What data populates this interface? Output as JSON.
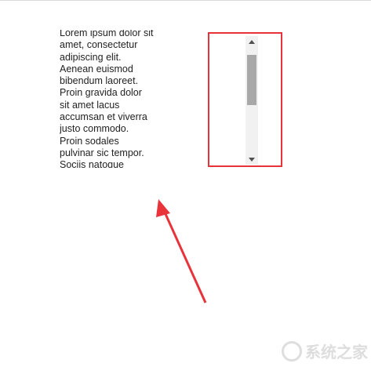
{
  "content": {
    "paragraph": "Lorem ipsum dolor sit\namet, consectetur\nadipiscing elit.\nAenean euismod\nbibendum laoreet.\nProin gravida dolor\nsit amet lacus\naccumsan et viverra\njusto commodo.\nProin sodales\npulvinar sic tempor.\nSociis natoque"
  },
  "scrollbar": {
    "up_arrow_icon": "scroll-up-arrow-icon",
    "down_arrow_icon": "scroll-down-arrow-icon",
    "thumb_position_fraction": 0.0
  },
  "annotation": {
    "box_color": "#e8333a",
    "arrow_color": "#e8333a"
  },
  "watermark": {
    "text": "系统之家"
  }
}
